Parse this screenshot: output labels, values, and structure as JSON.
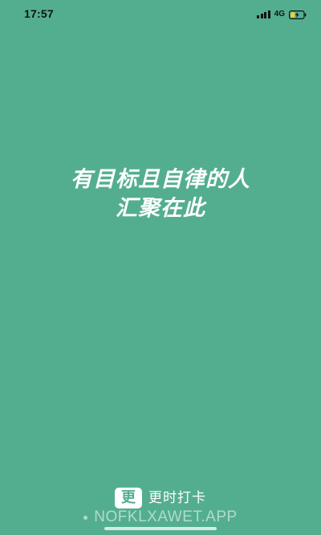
{
  "colors": {
    "background": "#53ae90",
    "status_text": "#121212",
    "slogan_text": "#ffffff",
    "battery_charge": "#f1d12c"
  },
  "status_bar": {
    "time": "17:57",
    "network": "4G",
    "icons": [
      "signal-icon",
      "battery-charging-icon"
    ]
  },
  "slogan": {
    "line1": "有目标且自律的人",
    "line2": "汇聚在此"
  },
  "brand": {
    "logo_char": "更",
    "name": "更时打卡"
  },
  "watermark": {
    "text": "NOFKLXAWET.APP"
  }
}
